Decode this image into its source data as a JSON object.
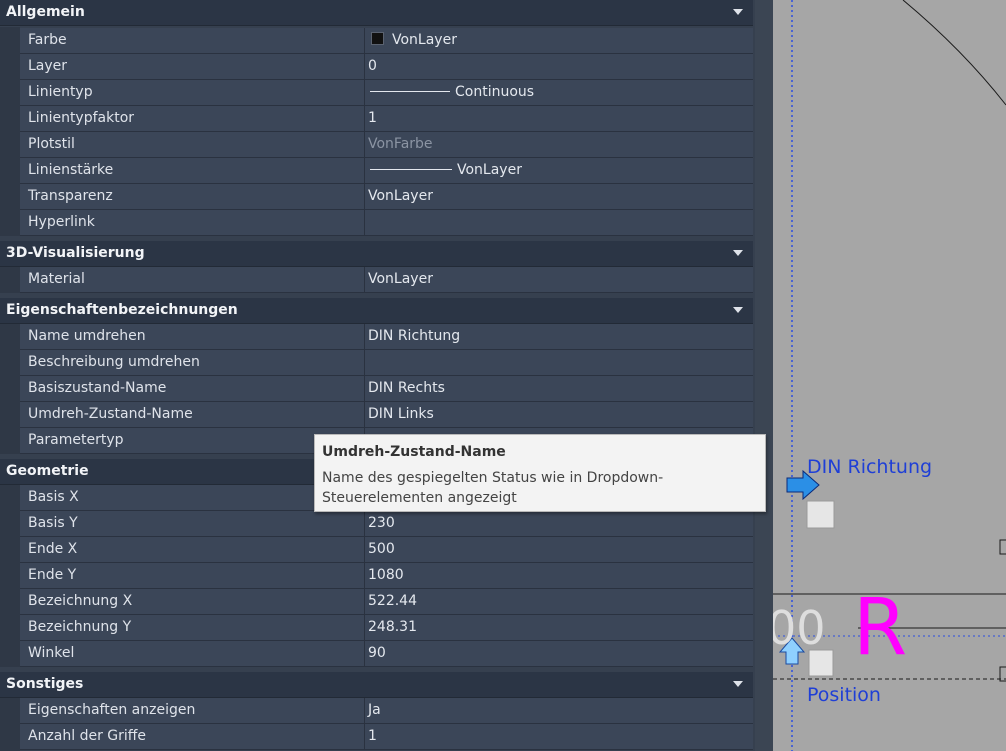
{
  "sections": {
    "allgemein": {
      "title": "Allgemein",
      "rows": [
        {
          "name": "Farbe",
          "value": "VonLayer"
        },
        {
          "name": "Layer",
          "value": "0"
        },
        {
          "name": "Linientyp",
          "value": "Continuous"
        },
        {
          "name": "Linientypfaktor",
          "value": "1"
        },
        {
          "name": "Plotstil",
          "value": "VonFarbe"
        },
        {
          "name": "Linienstärke",
          "value": "VonLayer"
        },
        {
          "name": "Transparenz",
          "value": "VonLayer"
        },
        {
          "name": "Hyperlink",
          "value": ""
        }
      ]
    },
    "visualisierung": {
      "title": "3D-Visualisierung",
      "rows": [
        {
          "name": "Material",
          "value": "VonLayer"
        }
      ]
    },
    "bezeichnungen": {
      "title": "Eigenschaftenbezeichnungen",
      "rows": [
        {
          "name": "Name umdrehen",
          "value": "DIN Richtung"
        },
        {
          "name": "Beschreibung umdrehen",
          "value": ""
        },
        {
          "name": "Basiszustand-Name",
          "value": "DIN Rechts"
        },
        {
          "name": "Umdreh-Zustand-Name",
          "value": "DIN Links"
        },
        {
          "name": "Parametertyp",
          "value": ""
        }
      ]
    },
    "geometrie": {
      "title": "Geometrie",
      "rows": [
        {
          "name": "Basis X",
          "value": ""
        },
        {
          "name": "Basis Y",
          "value": "230"
        },
        {
          "name": "Ende X",
          "value": "500"
        },
        {
          "name": "Ende Y",
          "value": "1080"
        },
        {
          "name": "Bezeichnung X",
          "value": "522.44"
        },
        {
          "name": "Bezeichnung Y",
          "value": "248.31"
        },
        {
          "name": "Winkel",
          "value": "90"
        }
      ]
    },
    "sonstiges": {
      "title": "Sonstiges",
      "rows": [
        {
          "name": "Eigenschaften anzeigen",
          "value": "Ja"
        },
        {
          "name": "Anzahl der Griffe",
          "value": "1"
        }
      ]
    }
  },
  "tooltip": {
    "title": "Umdreh-Zustand-Name",
    "description": "Name des gespiegelten Status wie in Dropdown-Steuerelementen angezeigt"
  },
  "canvas": {
    "flip_label": "DIN Richtung",
    "position_label": "Position",
    "big_text_partial": "00",
    "magenta_text_partial": "R"
  },
  "colors": {
    "canvas_bg": "#a6a6a6",
    "param_blue": "#1f3fd6",
    "magenta": "#ff00ff",
    "grip_blue": "#2b8fe6"
  }
}
